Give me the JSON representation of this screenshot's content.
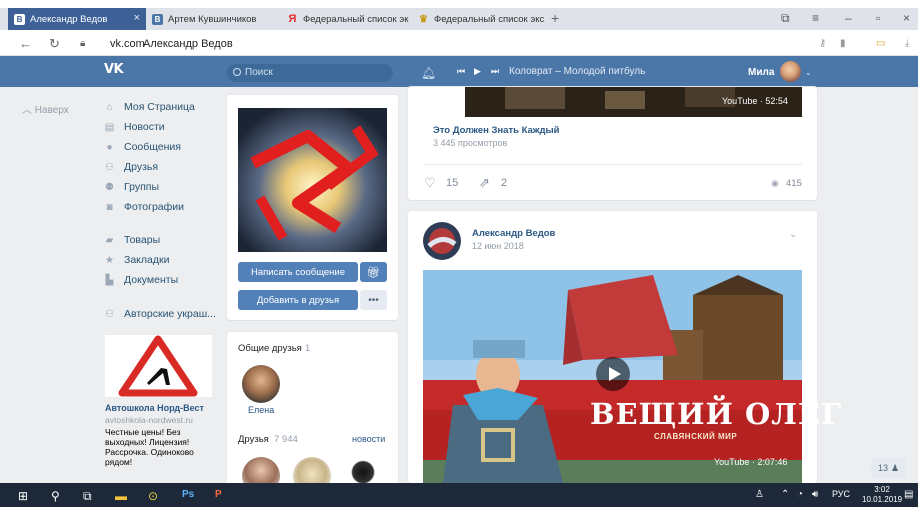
{
  "browser": {
    "tabs": [
      {
        "label": "Александр Ведов",
        "icon": "vk-tab-icon",
        "active": true,
        "close": "×"
      },
      {
        "label": "Артем Кувшинчиков",
        "icon": "vk-tab-icon"
      },
      {
        "label": "Федеральный список экст",
        "icon": "yandex-tab-icon"
      },
      {
        "label": "Федеральный список экст",
        "icon": "gov-tab-icon"
      }
    ],
    "new_tab": "+",
    "window_controls": {
      "minimize": "–",
      "maximize": "ᴗ",
      "close": "×"
    },
    "url_domain": "vk.com",
    "url_title": "Александр Ведов"
  },
  "header": {
    "logo": "VK",
    "search_placeholder": "Поиск",
    "track": "Коловрат – Молодой питбуль",
    "user_name": "Мила"
  },
  "sidebar": {
    "back_label": "Наверх",
    "items": [
      {
        "label": "Моя Страница",
        "icon": "home-icon"
      },
      {
        "label": "Новости",
        "icon": "news-icon"
      },
      {
        "label": "Сообщения",
        "icon": "messages-icon"
      },
      {
        "label": "Друзья",
        "icon": "friends-icon"
      },
      {
        "label": "Группы",
        "icon": "groups-icon"
      },
      {
        "label": "Фотографии",
        "icon": "photos-icon"
      },
      {
        "label": "Товары",
        "icon": "market-icon"
      },
      {
        "label": "Закладки",
        "icon": "star-icon"
      },
      {
        "label": "Документы",
        "icon": "docs-icon"
      },
      {
        "label": "Авторские украш...",
        "icon": "community-icon"
      }
    ],
    "ad": {
      "title": "Автошкола Норд-Вест",
      "domain": "avtoshkola-nordwest.ru",
      "text": "Честные цены! Без выходных! Лицензия! Рассрочка. Одиноково рядом!"
    }
  },
  "profile": {
    "send_message": "Написать сообщение",
    "add_friend": "Добавить в друзья",
    "more": "•••",
    "mutual_label": "Общие друзья",
    "mutual_count": "1",
    "mutual_friend": "Елена",
    "friends_label": "Друзья",
    "friends_count": "7 944",
    "friends_news": "новости"
  },
  "feed": {
    "post1": {
      "video_badge": "YouTube · 52:54",
      "title": "Это Должен Знать Каждый",
      "views_text": "3 445 просмотров",
      "likes": "15",
      "shares": "2",
      "views": "415"
    },
    "post2": {
      "author": "Александр Ведов",
      "date": "12 июн 2018",
      "video_title": "ВЕЩИЙ ОЛЕГ",
      "video_subtitle": "СЛАВЯНСКИЙ МИР",
      "video_badge": "YouTube · 2:07:46"
    }
  },
  "notifications": {
    "count": "13"
  },
  "taskbar": {
    "lang": "РУС",
    "time": "3:02",
    "date": "10.01.2019"
  },
  "colors": {
    "vk_blue": "#4a76a8",
    "page_bg": "#edeef0",
    "link": "#2a5885"
  }
}
